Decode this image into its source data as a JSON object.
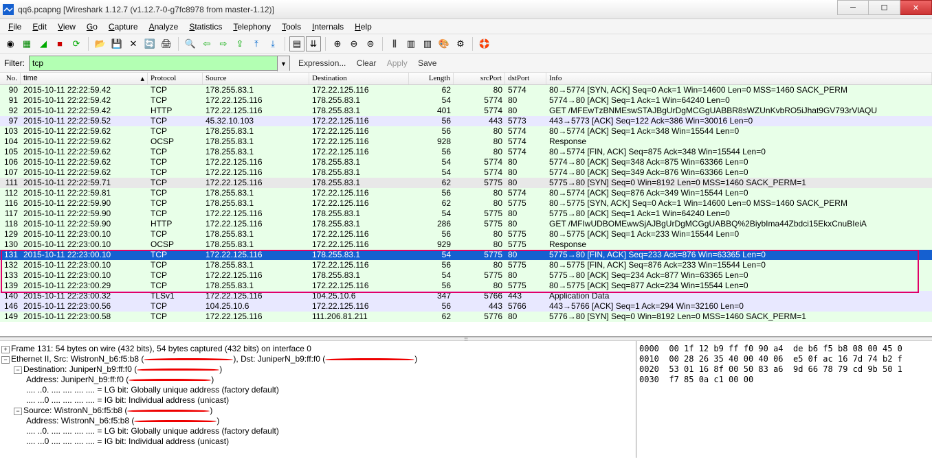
{
  "window": {
    "title": "qq6.pcapng   [Wireshark 1.12.7  (v1.12.7-0-g7fc8978 from master-1.12)]"
  },
  "menu": [
    "File",
    "Edit",
    "View",
    "Go",
    "Capture",
    "Analyze",
    "Statistics",
    "Telephony",
    "Tools",
    "Internals",
    "Help"
  ],
  "filter": {
    "label": "Filter:",
    "value": "tcp",
    "actions": {
      "expression": "Expression...",
      "clear": "Clear",
      "apply": "Apply",
      "save": "Save"
    }
  },
  "columns": [
    "No.",
    "time",
    "",
    "Protocol",
    "Source",
    "Destination",
    "Length",
    "srcPort",
    "dstPort",
    "Info"
  ],
  "packets": [
    {
      "no": "90",
      "time": "2015-10-11 22:22:59.42",
      "proto": "TCP",
      "src": "178.255.83.1",
      "dst": "172.22.125.116",
      "len": "62",
      "sport": "80",
      "dport": "5774",
      "info": "80→5774 [SYN, ACK] Seq=0 Ack=1 Win=14600 Len=0 MSS=1460 SACK_PERM",
      "cls": "greenrow"
    },
    {
      "no": "91",
      "time": "2015-10-11 22:22:59.42",
      "proto": "TCP",
      "src": "172.22.125.116",
      "dst": "178.255.83.1",
      "len": "54",
      "sport": "5774",
      "dport": "80",
      "info": "5774→80 [ACK] Seq=1 Ack=1 Win=64240 Len=0",
      "cls": "greenrow"
    },
    {
      "no": "92",
      "time": "2015-10-11 22:22:59.42",
      "proto": "HTTP",
      "src": "172.22.125.116",
      "dst": "178.255.83.1",
      "len": "401",
      "sport": "5774",
      "dport": "80",
      "info": "GET /MFEwTzBNMEswSTAJBgUrDgMCGgUABBR8sWZUnKvbRO5iJhat9GV793rVlAQU",
      "cls": "greenrow"
    },
    {
      "no": "97",
      "time": "2015-10-11 22:22:59.52",
      "proto": "TCP",
      "src": "45.32.10.103",
      "dst": "172.22.125.116",
      "len": "56",
      "sport": "443",
      "dport": "5773",
      "info": "443→5773 [ACK] Seq=122 Ack=386 Win=30016 Len=0",
      "cls": "bluerow"
    },
    {
      "no": "103",
      "time": "2015-10-11 22:22:59.62",
      "proto": "TCP",
      "src": "178.255.83.1",
      "dst": "172.22.125.116",
      "len": "56",
      "sport": "80",
      "dport": "5774",
      "info": "80→5774 [ACK] Seq=1 Ack=348 Win=15544 Len=0",
      "cls": "greenrow"
    },
    {
      "no": "104",
      "time": "2015-10-11 22:22:59.62",
      "proto": "OCSP",
      "src": "178.255.83.1",
      "dst": "172.22.125.116",
      "len": "928",
      "sport": "80",
      "dport": "5774",
      "info": "Response",
      "cls": "greenrow"
    },
    {
      "no": "105",
      "time": "2015-10-11 22:22:59.62",
      "proto": "TCP",
      "src": "178.255.83.1",
      "dst": "172.22.125.116",
      "len": "56",
      "sport": "80",
      "dport": "5774",
      "info": "80→5774 [FIN, ACK] Seq=875 Ack=348 Win=15544 Len=0",
      "cls": "greenrow"
    },
    {
      "no": "106",
      "time": "2015-10-11 22:22:59.62",
      "proto": "TCP",
      "src": "172.22.125.116",
      "dst": "178.255.83.1",
      "len": "54",
      "sport": "5774",
      "dport": "80",
      "info": "5774→80 [ACK] Seq=348 Ack=875 Win=63366 Len=0",
      "cls": "greenrow"
    },
    {
      "no": "107",
      "time": "2015-10-11 22:22:59.62",
      "proto": "TCP",
      "src": "172.22.125.116",
      "dst": "178.255.83.1",
      "len": "54",
      "sport": "5774",
      "dport": "80",
      "info": "5774→80 [ACK] Seq=349 Ack=876 Win=63366 Len=0",
      "cls": "greenrow"
    },
    {
      "no": "111",
      "time": "2015-10-11 22:22:59.71",
      "proto": "TCP",
      "src": "172.22.125.116",
      "dst": "178.255.83.1",
      "len": "62",
      "sport": "5775",
      "dport": "80",
      "info": "5775→80 [SYN] Seq=0 Win=8192 Len=0 MSS=1460 SACK_PERM=1",
      "cls": "greyrow"
    },
    {
      "no": "112",
      "time": "2015-10-11 22:22:59.81",
      "proto": "TCP",
      "src": "178.255.83.1",
      "dst": "172.22.125.116",
      "len": "56",
      "sport": "80",
      "dport": "5774",
      "info": "80→5774 [ACK] Seq=876 Ack=349 Win=15544 Len=0",
      "cls": "greenrow"
    },
    {
      "no": "116",
      "time": "2015-10-11 22:22:59.90",
      "proto": "TCP",
      "src": "178.255.83.1",
      "dst": "172.22.125.116",
      "len": "62",
      "sport": "80",
      "dport": "5775",
      "info": "80→5775 [SYN, ACK] Seq=0 Ack=1 Win=14600 Len=0 MSS=1460 SACK_PERM",
      "cls": "greenrow"
    },
    {
      "no": "117",
      "time": "2015-10-11 22:22:59.90",
      "proto": "TCP",
      "src": "172.22.125.116",
      "dst": "178.255.83.1",
      "len": "54",
      "sport": "5775",
      "dport": "80",
      "info": "5775→80 [ACK] Seq=1 Ack=1 Win=64240 Len=0",
      "cls": "greenrow"
    },
    {
      "no": "118",
      "time": "2015-10-11 22:22:59.90",
      "proto": "HTTP",
      "src": "172.22.125.116",
      "dst": "178.255.83.1",
      "len": "286",
      "sport": "5775",
      "dport": "80",
      "info": "GET /MFIwUDBOMEwwSjAJBgUrDgMCGgUABBQ%2BiybIma44Zbdci15EkxCnuBIeiA",
      "cls": "greenrow"
    },
    {
      "no": "129",
      "time": "2015-10-11 22:23:00.10",
      "proto": "TCP",
      "src": "178.255.83.1",
      "dst": "172.22.125.116",
      "len": "56",
      "sport": "80",
      "dport": "5775",
      "info": "80→5775 [ACK] Seq=1 Ack=233 Win=15544 Len=0",
      "cls": "greenrow"
    },
    {
      "no": "130",
      "time": "2015-10-11 22:23:00.10",
      "proto": "OCSP",
      "src": "178.255.83.1",
      "dst": "172.22.125.116",
      "len": "929",
      "sport": "80",
      "dport": "5775",
      "info": "Response",
      "cls": "greenrow"
    },
    {
      "no": "131",
      "time": "2015-10-11 22:23:00.10",
      "proto": "TCP",
      "src": "172.22.125.116",
      "dst": "178.255.83.1",
      "len": "54",
      "sport": "5775",
      "dport": "80",
      "info": "5775→80 [FIN, ACK] Seq=233 Ack=876 Win=63365 Len=0",
      "cls": "selected"
    },
    {
      "no": "132",
      "time": "2015-10-11 22:23:00.10",
      "proto": "TCP",
      "src": "178.255.83.1",
      "dst": "172.22.125.116",
      "len": "56",
      "sport": "80",
      "dport": "5775",
      "info": "80→5775 [FIN, ACK] Seq=876 Ack=233 Win=15544 Len=0",
      "cls": "greenrow"
    },
    {
      "no": "133",
      "time": "2015-10-11 22:23:00.10",
      "proto": "TCP",
      "src": "172.22.125.116",
      "dst": "178.255.83.1",
      "len": "54",
      "sport": "5775",
      "dport": "80",
      "info": "5775→80 [ACK] Seq=234 Ack=877 Win=63365 Len=0",
      "cls": "greenrow"
    },
    {
      "no": "139",
      "time": "2015-10-11 22:23:00.29",
      "proto": "TCP",
      "src": "178.255.83.1",
      "dst": "172.22.125.116",
      "len": "56",
      "sport": "80",
      "dport": "5775",
      "info": "80→5775 [ACK] Seq=877 Ack=234 Win=15544 Len=0",
      "cls": "greenrow"
    },
    {
      "no": "140",
      "time": "2015-10-11 22:23:00.32",
      "proto": "TLSv1",
      "src": "172.22.125.116",
      "dst": "104.25.10.6",
      "len": "347",
      "sport": "5766",
      "dport": "443",
      "info": "Application Data",
      "cls": "bluerow"
    },
    {
      "no": "146",
      "time": "2015-10-11 22:23:00.56",
      "proto": "TCP",
      "src": "104.25.10.6",
      "dst": "172.22.125.116",
      "len": "56",
      "sport": "443",
      "dport": "5766",
      "info": "443→5766 [ACK] Seq=1 Ack=294 Win=32160 Len=0",
      "cls": "bluerow"
    },
    {
      "no": "149",
      "time": "2015-10-11 22:23:00.58",
      "proto": "TCP",
      "src": "172.22.125.116",
      "dst": "111.206.81.211",
      "len": "62",
      "sport": "5776",
      "dport": "80",
      "info": "5776→80 [SYN] Seq=0 Win=8192 Len=0 MSS=1460 SACK_PERM=1",
      "cls": "greenrow"
    }
  ],
  "details": {
    "frame": "Frame 131: 54 bytes on wire (432 bits), 54 bytes captured (432 bits) on interface 0",
    "eth": "Ethernet II, Src: WistronN_b6:f5:b8 ",
    "eth2": ", Dst: JuniperN_b9:ff:f0 ",
    "dest": "Destination: JuniperN_b9:ff:f0 ",
    "destAddr": "Address: JuniperN_b9:ff:f0 ",
    "lg": ".... ..0. .... .... .... .... = LG bit: Globally unique address (factory default)",
    "ig": ".... ...0 .... .... .... .... = IG bit: Individual address (unicast)",
    "source": "Source: WistronN_b6:f5:b8 ",
    "srcAddr": "Address: WistronN_b6:f5:b8 "
  },
  "hex": [
    "0000  00 1f 12 b9 ff f0 90 a4  de b6 f5 b8 08 00 45 0",
    "0010  00 28 26 35 40 00 40 06  e5 0f ac 16 7d 74 b2 f",
    "0020  53 01 16 8f 00 50 83 a6  9d 66 78 79 cd 9b 50 1",
    "0030  f7 85 0a c1 00 00"
  ]
}
